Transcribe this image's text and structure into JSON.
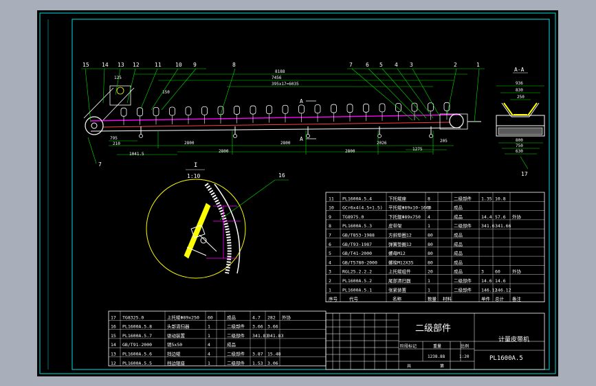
{
  "colors": {
    "background": "#a9afba",
    "sheet": "#000000",
    "frame": "#00e0e0",
    "text": "#ffffff",
    "dimension": "#00e000",
    "idler": "#ffffff",
    "highlight": "#ff00ff",
    "yellow": "#ffff00"
  },
  "leaders": [
    "15",
    "14",
    "13",
    "12",
    "11",
    "10",
    "9",
    "8",
    "7",
    "6",
    "5",
    "4",
    "3",
    "2",
    "1"
  ],
  "leader_7b": "7",
  "dims": {
    "overall": "8188",
    "span": "7456",
    "pitch": "395x17=6035",
    "d125": "125",
    "d150": "150",
    "seg1": "2800",
    "seg2": "2800",
    "seg3": "2800",
    "seg4": "2800",
    "seg5": "2026",
    "d795": "795",
    "d210": "210",
    "d1041": "1041.5",
    "d1275": "1275",
    "d205": "205"
  },
  "section_a": {
    "mark_a1": "A",
    "mark_a2": "A"
  },
  "side_view": {
    "title": "A-A",
    "d936": "936",
    "d830": "830",
    "d250": "250",
    "d800": "800",
    "d750": "750",
    "d630": "630",
    "leader": "17"
  },
  "detail": {
    "title": "I",
    "scale": "1:10",
    "leader": "16"
  },
  "bom_top": [
    [
      "11",
      "PL1600A.5.4",
      "下托辊座",
      "8",
      "",
      "二级部件",
      "1.35",
      "10.8",
      ""
    ],
    [
      "10",
      "GCr6x4(4.5+1.5)",
      "平托辊Φ89x10-1600",
      "1",
      "",
      "成品",
      "",
      "",
      ""
    ],
    [
      "9",
      "TG8975.0",
      "下托辊Φ89x750",
      "4",
      "",
      "成品",
      "14.4",
      "57.6",
      "外协"
    ],
    [
      "8",
      "PL1600A.5.3",
      "皮带架",
      "1",
      "",
      "二级部件",
      "341.6",
      "341.66",
      ""
    ],
    [
      "7",
      "GB/T853-1988",
      "方斜垫圈12",
      "80",
      "",
      "成品",
      "",
      "",
      ""
    ],
    [
      "6",
      "GB/T93-1987",
      "弹簧垫圈12",
      "80",
      "",
      "成品",
      "",
      "",
      ""
    ],
    [
      "5",
      "GB/T41-2000",
      "螺母M12",
      "80",
      "",
      "成品",
      "",
      "",
      ""
    ],
    [
      "4",
      "GB/T5780-2000",
      "螺栓M12X35",
      "80",
      "",
      "成品",
      "",
      "",
      ""
    ],
    [
      "3",
      "RGL25.2.2.2",
      "上托辊组件",
      "20",
      "",
      "成品",
      "3",
      "60",
      "外协"
    ],
    [
      "2",
      "PL1600A.5.2",
      "尾部清扫器",
      "1",
      "",
      "二级部件",
      "14.6",
      "14.6",
      ""
    ],
    [
      "1",
      "PL1600A.5.1",
      "张紧装置",
      "1",
      "",
      "二级部件",
      "146.12",
      "146.12",
      ""
    ]
  ],
  "bom_header": [
    "序号",
    "代号",
    "名称",
    "数量",
    "材料",
    "单件",
    "总计",
    "备注"
  ],
  "bom_bottom": [
    [
      "17",
      "TG8325.0",
      "上托辊Φ89x250",
      "60",
      "",
      "成品",
      "4.7",
      "282",
      "外协"
    ],
    [
      "16",
      "PL1600A.5.8",
      "头部清扫器",
      "1",
      "",
      "二级部件",
      "3.66",
      "3.66",
      ""
    ],
    [
      "15",
      "PL1600A.5.7",
      "驱动装置",
      "1",
      "",
      "二级部件",
      "341.83",
      "341.83",
      ""
    ],
    [
      "14",
      "GB/T91-2000",
      "销5x50",
      "4",
      "",
      "成品",
      "",
      "",
      ""
    ],
    [
      "13",
      "PL1600A.5.6",
      "挡边辊",
      "4",
      "",
      "二级部件",
      "3.87",
      "15.48",
      ""
    ],
    [
      "12",
      "PL1600A.5.5",
      "挡边辊座",
      "1",
      "",
      "二级部件",
      "1.53",
      "3.06",
      ""
    ]
  ],
  "title_block": {
    "part_type": "二级部件",
    "machine_name": "计量皮带机",
    "drawing_no": "PL1600A.5",
    "weight": "1238.88",
    "scale": "1:20",
    "label_stage": "阶段标记",
    "label_weight": "重量",
    "label_scale": "比例",
    "sheet_total": "共",
    "sheet_no": "第"
  }
}
